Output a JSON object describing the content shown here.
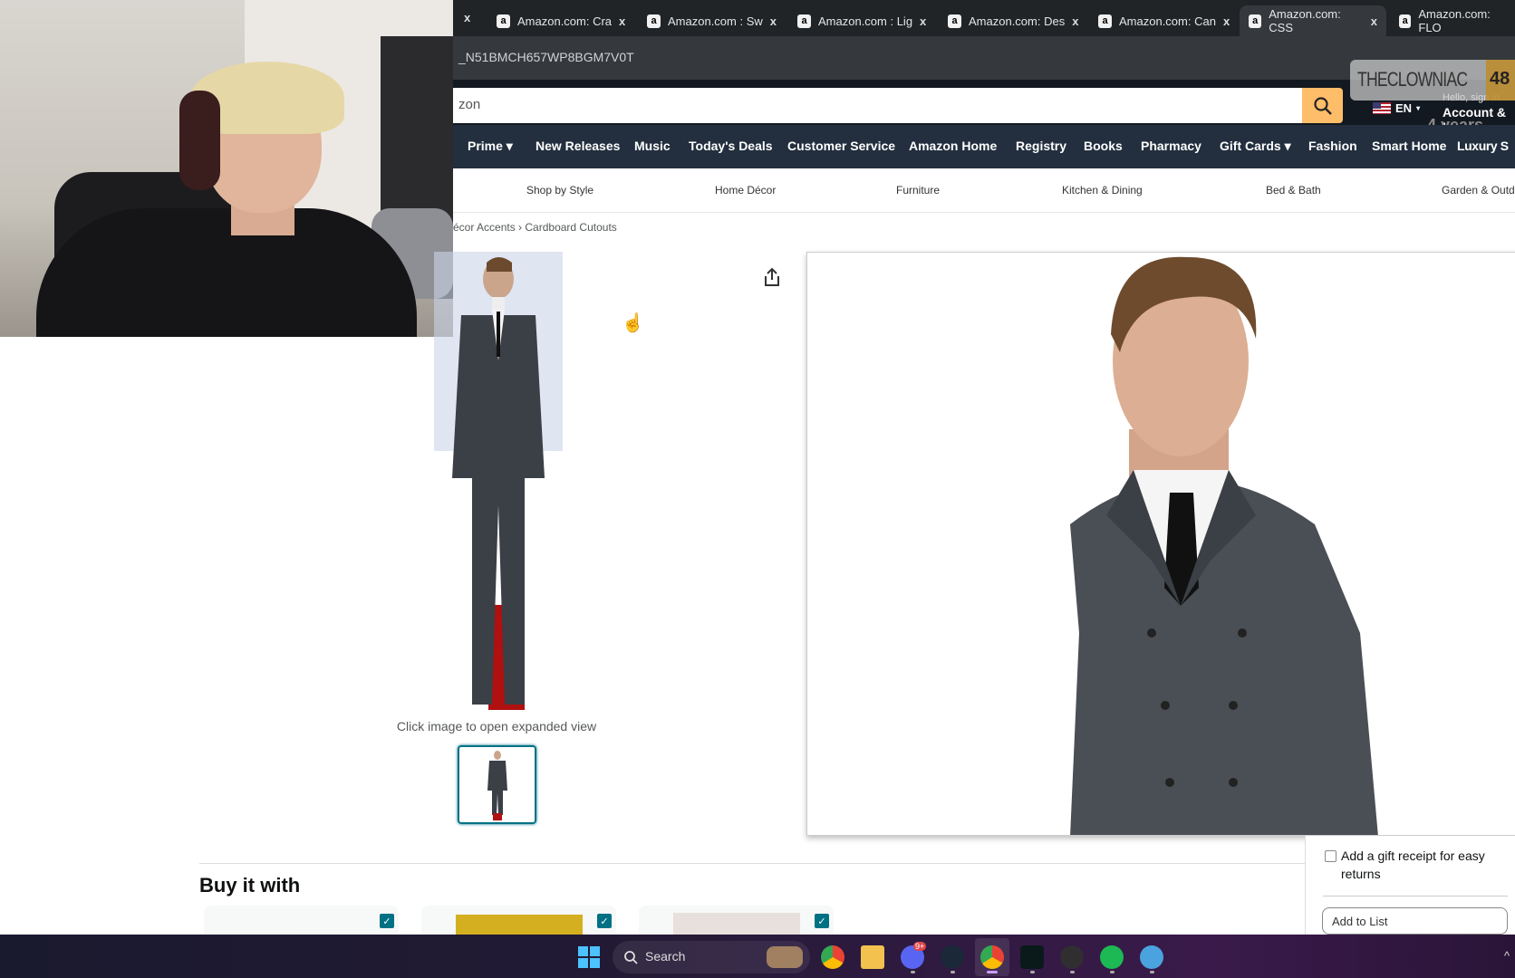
{
  "browser": {
    "tabs": [
      {
        "title": "Amazon.com: Cra",
        "favicon": "amazon-icon"
      },
      {
        "title": "Amazon.com : Sw",
        "favicon": "amazon-icon"
      },
      {
        "title": "Amazon.com : Lig",
        "favicon": "amazon-icon"
      },
      {
        "title": "Amazon.com: Des",
        "favicon": "amazon-icon"
      },
      {
        "title": "Amazon.com: Can",
        "favicon": "amazon-icon"
      },
      {
        "title": "Amazon.com: CSS",
        "favicon": "amazon-icon",
        "active": true
      },
      {
        "title": "Amazon.com: FLO",
        "favicon": "amazon-icon"
      }
    ],
    "tab_close": "x",
    "url_fragment": "_N51BMCH657WP8BGM7V0T"
  },
  "header": {
    "search_text": "zon",
    "language": "EN",
    "hello": "Hello, sign in",
    "account": "Account & L"
  },
  "stream_overlay": {
    "name": "THECLOWNIAC",
    "count": "48",
    "years": "4 years"
  },
  "nav": {
    "items": [
      "Prime ▾",
      "New Releases",
      "Music",
      "Today's Deals",
      "Customer Service",
      "Amazon Home",
      "Registry",
      "Books",
      "Pharmacy",
      "Gift Cards ▾",
      "Fashion",
      "Smart Home",
      "Luxury S"
    ]
  },
  "subnav": {
    "items": [
      "Shop by Style",
      "Home Décor",
      "Furniture",
      "Kitchen & Dining",
      "Bed & Bath",
      "Garden & Outd"
    ]
  },
  "breadcrumb": {
    "items": [
      "écor Accents",
      "Cardboard Cutouts"
    ],
    "separator": "›"
  },
  "product": {
    "caption": "Click image to open expanded view"
  },
  "buy_it_with": {
    "title": "Buy it with",
    "check": "✓"
  },
  "right_panel": {
    "gift_receipt": "Add a gift receipt for easy returns",
    "add_to_list": "Add to List"
  },
  "taskbar": {
    "search": "Search",
    "discord_badge": "9+"
  },
  "colors": {
    "amazon_dark": "#131921",
    "amazon_nav": "#232f3e",
    "search_button": "#febd69",
    "teal": "#007185"
  }
}
